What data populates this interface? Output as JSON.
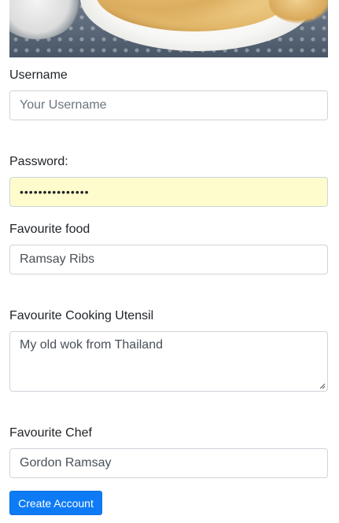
{
  "form": {
    "username_label": "Username",
    "username_placeholder": "Your Username",
    "password_label": "Password:",
    "password_value": "•••••••••••••••",
    "food_label": "Favourite food",
    "food_value": "Ramsay Ribs",
    "utensil_label": "Favourite Cooking Utensil",
    "utensil_value": "My old wok from Thailand",
    "chef_label": "Favourite Chef",
    "chef_value": "Gordon Ramsay",
    "submit_label": "Create Account"
  },
  "colors": {
    "button": "#0d7bf5",
    "autofill": "#fefccd"
  }
}
